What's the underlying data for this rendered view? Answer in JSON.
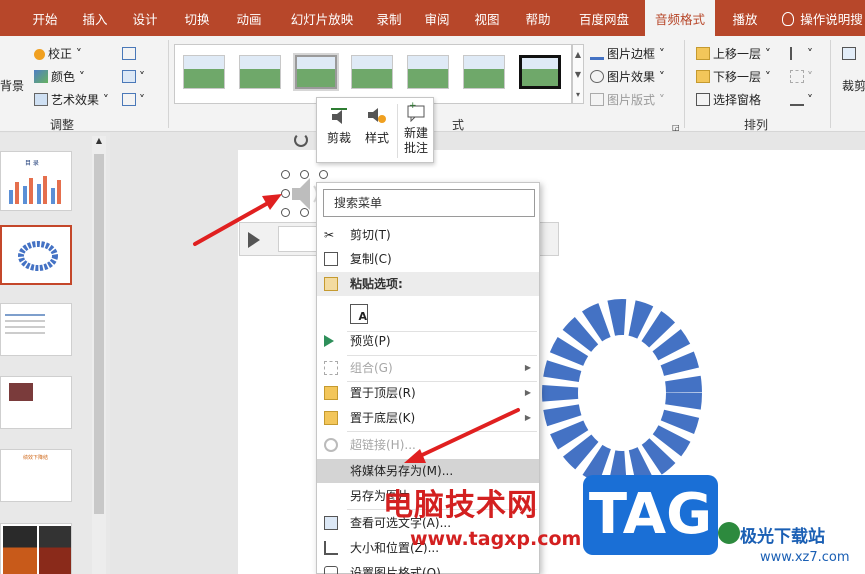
{
  "tabs": [
    {
      "label": "",
      "sel": false
    },
    {
      "label": "开始",
      "sel": false
    },
    {
      "label": "插入",
      "sel": false
    },
    {
      "label": "设计",
      "sel": false
    },
    {
      "label": "切换",
      "sel": false
    },
    {
      "label": "动画",
      "sel": false
    },
    {
      "label": "幻灯片放映",
      "sel": false
    },
    {
      "label": "录制",
      "sel": false
    },
    {
      "label": "审阅",
      "sel": false
    },
    {
      "label": "视图",
      "sel": false
    },
    {
      "label": "帮助",
      "sel": false
    },
    {
      "label": "百度网盘",
      "sel": false
    },
    {
      "label": "音频格式",
      "sel": true
    },
    {
      "label": "播放",
      "sel": false
    }
  ],
  "help_label": "操作说明搜",
  "ribbon": {
    "bg_remove": "背景",
    "correct": "校正",
    "color": "颜色",
    "artistic": "艺术效果",
    "adjust_group": "调整",
    "styles_group": "式",
    "border": "图片边框",
    "effects": "图片效果",
    "layout": "图片版式",
    "bring_forward": "上移一层",
    "send_backward": "下移一层",
    "selection_pane": "选择窗格",
    "arrange_group": "排列",
    "crop": "裁剪"
  },
  "mini_toolbar": {
    "trim": "剪裁",
    "style": "样式",
    "new_comment": "新建\n批注"
  },
  "slide_thumb": {
    "title": "目 录",
    "title5": "绩效下降结"
  },
  "context_menu": {
    "search_placeholder": "搜索菜单",
    "items": [
      {
        "label": "剪切(T)",
        "state": "normal",
        "icon": "scissors-icon"
      },
      {
        "label": "复制(C)",
        "state": "normal",
        "icon": "copy-icon"
      },
      {
        "label": "粘贴选项:",
        "state": "header",
        "icon": "paste-icon"
      },
      {
        "label": "",
        "state": "paste-a",
        "icon": "paste-keep-text-icon"
      },
      {
        "label": "预览(P)",
        "state": "normal",
        "icon": "play-icon"
      },
      {
        "label": "组合(G)",
        "state": "disabled",
        "icon": "group-icon",
        "submenu": true
      },
      {
        "label": "置于顶层(R)",
        "state": "normal",
        "icon": "bring-front-icon",
        "submenu": true
      },
      {
        "label": "置于底层(K)",
        "state": "normal",
        "icon": "send-back-icon",
        "submenu": true
      },
      {
        "label": "超链接(H)...",
        "state": "disabled",
        "icon": "link-icon"
      },
      {
        "label": "将媒体另存为(M)...",
        "state": "highlight",
        "icon": ""
      },
      {
        "label": "另存为图片",
        "state": "normal",
        "icon": ""
      },
      {
        "label": "查看可选文字(A)...",
        "state": "normal",
        "icon": "alt-text-icon"
      },
      {
        "label": "大小和位置(Z)...",
        "state": "normal",
        "icon": "size-position-icon"
      },
      {
        "label": "设置图片格式(O)...",
        "state": "normal",
        "icon": "format-picture-icon"
      }
    ]
  },
  "watermark": {
    "text": "电脑技术网",
    "url": "www.tagxp.com",
    "tag": "TAG",
    "site": "极光下载站",
    "site_url": "www.xz7.com"
  },
  "colors": {
    "accent": "#b7472a",
    "ring": "#4472c4",
    "arrow": "#e02020"
  }
}
